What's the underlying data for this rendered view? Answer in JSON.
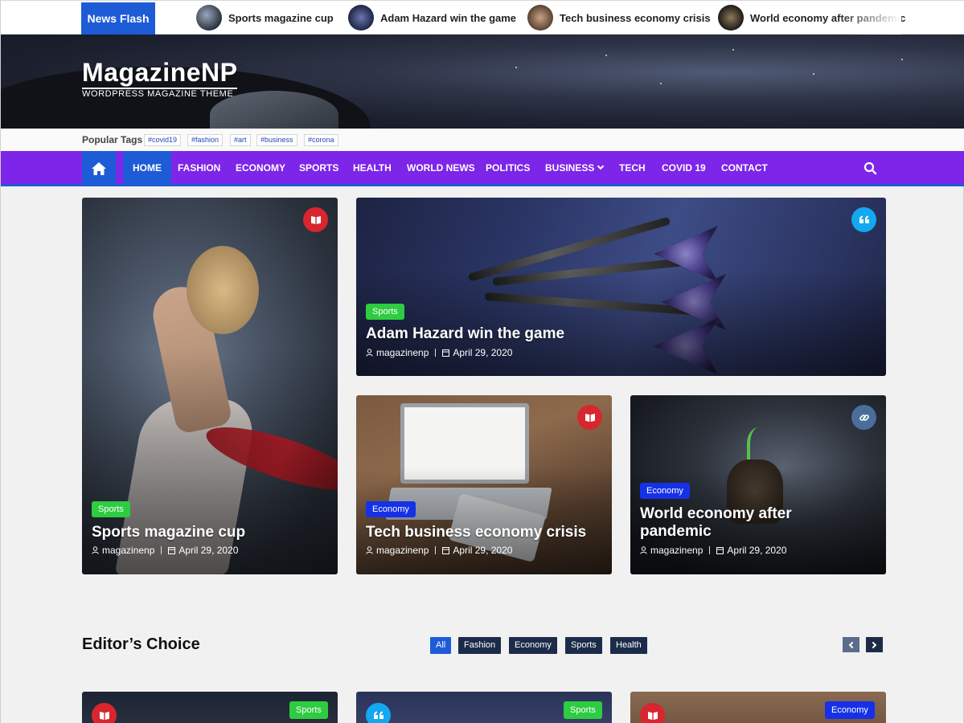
{
  "news_flash": {
    "label": "News Flash",
    "items": [
      {
        "title": "Sports magazine cup"
      },
      {
        "title": "Adam Hazard win the game"
      },
      {
        "title": "Tech business economy crisis"
      },
      {
        "title": "World economy after pandemic"
      }
    ]
  },
  "header": {
    "site_title": "MagazineNP",
    "tagline": "WORDPRESS MAGAZINE THEME"
  },
  "popular_tags": {
    "label": "Popular Tags",
    "tags": [
      "#covid19",
      "#fashion",
      "#art",
      "#business",
      "#corona"
    ]
  },
  "nav": {
    "items": [
      "HOME",
      "FASHION",
      "ECONOMY",
      "SPORTS",
      "HEALTH",
      "WORLD NEWS",
      "POLITICS",
      "BUSINESS",
      "TECH",
      "COVID 19",
      "CONTACT"
    ],
    "active": "HOME"
  },
  "featured": [
    {
      "category": "Sports",
      "title": "Sports magazine cup",
      "author": "magazinenp",
      "date": "April 29, 2020",
      "badge_icon": "book-icon"
    },
    {
      "category": "Sports",
      "title": "Adam Hazard win the game",
      "author": "magazinenp",
      "date": "April 29, 2020",
      "badge_icon": "quote-icon"
    },
    {
      "category": "Economy",
      "title": "Tech business economy crisis",
      "author": "magazinenp",
      "date": "April 29, 2020",
      "badge_icon": "book-icon"
    },
    {
      "category": "Economy",
      "title": "World economy after pandemic",
      "author": "magazinenp",
      "date": "April 29, 2020",
      "badge_icon": "link-icon"
    }
  ],
  "editors_choice": {
    "title": "Editor’s Choice",
    "filters": [
      "All",
      "Fashion",
      "Economy",
      "Sports",
      "Health"
    ],
    "active_filter": "All",
    "cards": [
      {
        "category": "Sports",
        "badge_icon": "book-icon"
      },
      {
        "category": "Sports",
        "badge_icon": "quote-icon"
      },
      {
        "category": "Economy",
        "badge_icon": "book-icon"
      }
    ]
  },
  "colors": {
    "accent": "#1e5bd6",
    "nav": "#7d25e8",
    "sports": "#2ecc40",
    "economy": "#1531e8"
  }
}
